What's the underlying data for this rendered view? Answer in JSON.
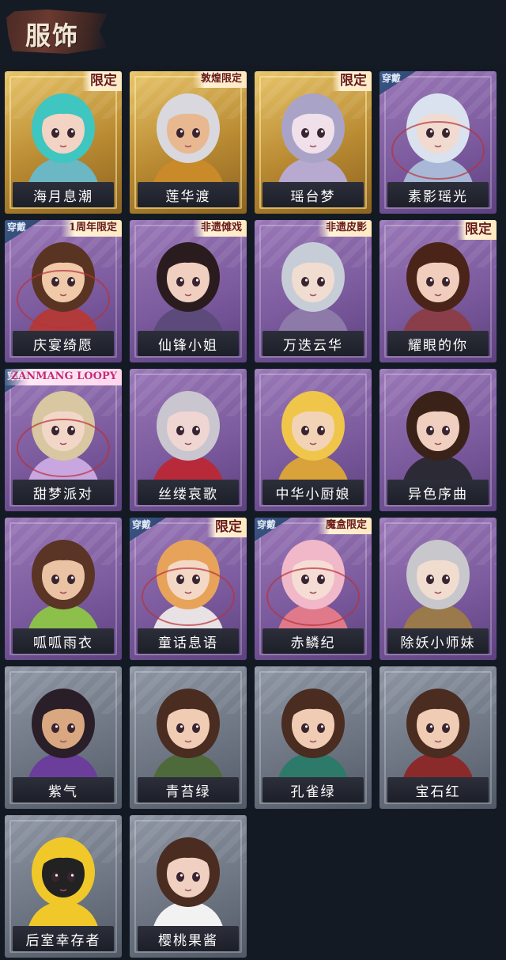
{
  "header": {
    "title": "服饰"
  },
  "accent": {
    "gold": "#c9a24a",
    "purple": "#7c5b9e",
    "gray": "#6e7684",
    "badge_text": "#6a1a12"
  },
  "items": [
    {
      "label": "海月息潮",
      "tier": "gold",
      "badge": "限定",
      "worn": false,
      "hair": "#3fc6c0",
      "skin": "#f3d3c4",
      "cloth": "#6bb7c4",
      "icon": "sea-nymph-portrait-icon"
    },
    {
      "label": "莲华渡",
      "tier": "gold",
      "badge": "敦煌限定",
      "worn": false,
      "hair": "#d8d8de",
      "skin": "#e8b890",
      "cloth": "#c98a2a",
      "icon": "lotus-youth-portrait-icon"
    },
    {
      "label": "瑶台梦",
      "tier": "gold",
      "badge": "限定",
      "worn": false,
      "hair": "#a9a3c8",
      "skin": "#efe0ea",
      "cloth": "#b7a9d0",
      "icon": "dream-terrace-portrait-icon"
    },
    {
      "label": "素影瑶光",
      "tier": "purple",
      "badge": "",
      "worn": true,
      "hair": "#d9e2ee",
      "skin": "#f1dbd0",
      "cloth": "#a8b8d6",
      "icon": "pale-light-portrait-icon"
    },
    {
      "label": "庆宴绮愿",
      "tier": "purple",
      "badge": "1周年限定",
      "worn": true,
      "hair": "#5a3422",
      "skin": "#efc9a8",
      "cloth": "#b23a3a",
      "icon": "anniversary-feast-portrait-icon"
    },
    {
      "label": "仙锋小姐",
      "tier": "purple",
      "badge": "非遗傩戏",
      "worn": false,
      "hair": "#2a1c1e",
      "skin": "#f0cfc0",
      "cloth": "#5b4a7a",
      "icon": "nuo-opera-portrait-icon"
    },
    {
      "label": "万迭云华",
      "tier": "purple",
      "badge": "非遗皮影",
      "worn": false,
      "hair": "#c7cdd6",
      "skin": "#f0dcd0",
      "cloth": "#8d7aa8",
      "icon": "shadow-puppet-portrait-icon"
    },
    {
      "label": "耀眼的你",
      "tier": "purple",
      "badge": "限定",
      "worn": false,
      "hair": "#4a2418",
      "skin": "#f0cdbc",
      "cloth": "#8a3e4a",
      "icon": "cowgirl-portrait-icon"
    },
    {
      "label": "甜梦派对",
      "tier": "purple",
      "badge": "ZANMANG LOOPY",
      "worn": true,
      "hair": "#d8c7a0",
      "skin": "#f2d7c8",
      "cloth": "#c8a6e0",
      "icon": "loopy-party-portrait-icon"
    },
    {
      "label": "丝缕哀歌",
      "tier": "purple",
      "badge": "",
      "worn": false,
      "hair": "#c9c6cf",
      "skin": "#efd6d2",
      "cloth": "#b82a3a",
      "icon": "lament-portrait-icon"
    },
    {
      "label": "中华小厨娘",
      "tier": "purple",
      "badge": "",
      "worn": false,
      "hair": "#f0c64a",
      "skin": "#f3d3b6",
      "cloth": "#d9a23a",
      "icon": "little-chef-portrait-icon"
    },
    {
      "label": "异色序曲",
      "tier": "purple",
      "badge": "",
      "worn": false,
      "hair": "#3a2218",
      "skin": "#f0cfc0",
      "cloth": "#2c2a34",
      "icon": "overture-portrait-icon"
    },
    {
      "label": "呱呱雨衣",
      "tier": "purple",
      "badge": "",
      "worn": false,
      "hair": "#5a3424",
      "skin": "#eac2a4",
      "cloth": "#8cc04a",
      "icon": "frog-raincoat-portrait-icon"
    },
    {
      "label": "童话息语",
      "tier": "purple",
      "badge": "限定",
      "worn": true,
      "hair": "#e8a35a",
      "skin": "#f3d8c6",
      "cloth": "#e8e2e4",
      "icon": "fairy-tale-portrait-icon"
    },
    {
      "label": "赤鳞纪",
      "tier": "purple",
      "badge": "魔盒限定",
      "worn": true,
      "hair": "#f0b8c8",
      "skin": "#f5dcd4",
      "cloth": "#e07a8a",
      "icon": "red-scale-portrait-icon"
    },
    {
      "label": "除妖小师妹",
      "tier": "purple",
      "badge": "",
      "worn": false,
      "hair": "#c8c8cc",
      "skin": "#f0ddd0",
      "cloth": "#9a7a4a",
      "icon": "exorcist-portrait-icon"
    },
    {
      "label": "紫气",
      "tier": "gray",
      "badge": "",
      "worn": false,
      "hair": "#2a1e28",
      "skin": "#d9a880",
      "cloth": "#6a3e9a",
      "icon": "purple-aura-portrait-icon"
    },
    {
      "label": "青苔绿",
      "tier": "gray",
      "badge": "",
      "worn": false,
      "hair": "#4a2c20",
      "skin": "#f0ccb4",
      "cloth": "#4f6a3a",
      "icon": "moss-green-portrait-icon"
    },
    {
      "label": "孔雀绿",
      "tier": "gray",
      "badge": "",
      "worn": false,
      "hair": "#4a2c20",
      "skin": "#f0ccb4",
      "cloth": "#2e7a6a",
      "icon": "peacock-green-portrait-icon"
    },
    {
      "label": "宝石红",
      "tier": "gray",
      "badge": "",
      "worn": false,
      "hair": "#4a2c20",
      "skin": "#f0ccb4",
      "cloth": "#8a2a2a",
      "icon": "ruby-red-portrait-icon"
    },
    {
      "label": "后室幸存者",
      "tier": "gray",
      "badge": "",
      "worn": false,
      "hair": "#f0c82a",
      "skin": "#222222",
      "cloth": "#f0c82a",
      "icon": "backrooms-survivor-portrait-icon"
    },
    {
      "label": "樱桃果酱",
      "tier": "gray",
      "badge": "",
      "worn": false,
      "hair": "#4a2c20",
      "skin": "#f0d0c0",
      "cloth": "#f2f2f2",
      "icon": "cherry-jam-portrait-icon"
    }
  ],
  "wear_label": "穿戴"
}
